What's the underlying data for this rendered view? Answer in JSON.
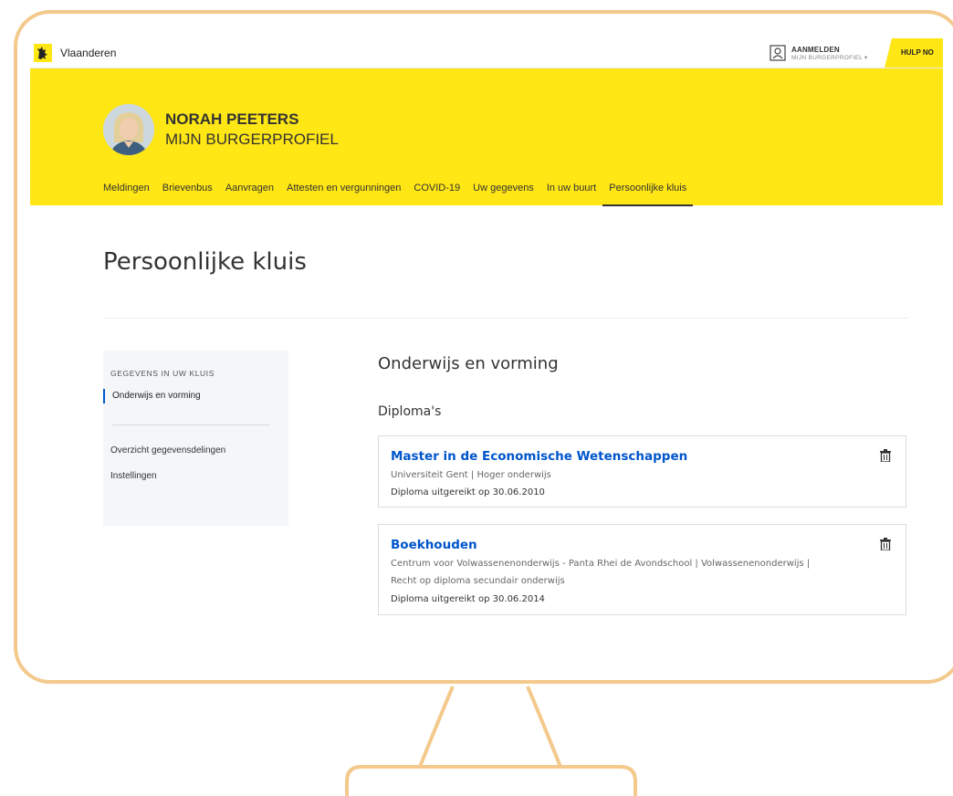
{
  "topbar": {
    "brand": "Vlaanderen",
    "login_title": "AANMELDEN",
    "login_sub": "MIJN BURGERPROFIEL ▾",
    "help_label": "HULP NO"
  },
  "header": {
    "name": "NORAH PEETERS",
    "profile_title": "MIJN BURGERPROFIEL",
    "nav": [
      {
        "label": "Meldingen"
      },
      {
        "label": "Brievenbus"
      },
      {
        "label": "Aanvragen"
      },
      {
        "label": "Attesten en vergunningen"
      },
      {
        "label": "COVID-19"
      },
      {
        "label": "Uw gegevens"
      },
      {
        "label": "In uw buurt"
      },
      {
        "label": "Persoonlijke kluis",
        "active": true
      }
    ]
  },
  "page": {
    "title": "Persoonlijke kluis"
  },
  "sidebar": {
    "heading": "GEGEVENS IN UW KLUIS",
    "active_item": "Onderwijs en vorming",
    "links": [
      "Overzicht gegevensdelingen",
      "Instellingen"
    ]
  },
  "main": {
    "section_title": "Onderwijs en vorming",
    "sub_title": "Diploma's",
    "diplomas": [
      {
        "title": "Master in de Economische Wetenschappen",
        "meta_lines": [
          "Universiteit Gent | Hoger onderwijs"
        ],
        "date": "Diploma uitgereikt op 30.06.2010"
      },
      {
        "title": "Boekhouden",
        "meta_lines": [
          "Centrum voor Volwassenenonderwijs - Panta Rhei de Avondschool | Volwassenenonderwijs |",
          "Recht op diploma secundair onderwijs"
        ],
        "date": "Diploma uitgereikt op 30.06.2014"
      }
    ]
  },
  "colors": {
    "brand_yellow": "#ffe615",
    "link_blue": "#0055cc",
    "frame_orange": "#f3c98c"
  }
}
